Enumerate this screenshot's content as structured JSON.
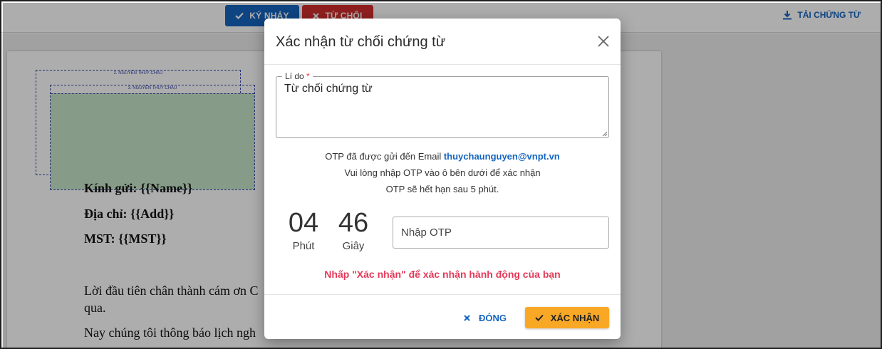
{
  "toolbar": {
    "sign_label": "KÝ NHÁY",
    "reject_label": "TỪ CHỐI",
    "download_label": "TẢI CHỨNG TỪ"
  },
  "document": {
    "signature_1": "2. NGUYỄN THÚY CHÂU",
    "signature_2": "3. NGUYỄN THÚY CHÂU",
    "recipient_line": "Kính gửi: {{Name}}",
    "address_line": "Địa chỉ: {{Add}}",
    "tax_line": "MST: {{MST}}",
    "para1_line1": "Lời đầu tiên chân thành cám ơn C",
    "para1_line2": "qua.",
    "para2_line1": "Nay chúng tôi thông báo lịch ngh"
  },
  "modal": {
    "title": "Xác nhận từ chối chứng từ",
    "reason_label": "Lí do",
    "reason_required": "*",
    "reason_value": "Từ chối chứng từ",
    "otp_sent_prefix": "OTP đã được gửi đến Email",
    "otp_email": "thuychaunguyen@vnpt.vn",
    "otp_instruction": "Vui lòng nhập OTP vào ô bên dưới để xác nhận",
    "otp_expiry": "OTP sẽ hết hạn sau 5 phút.",
    "timer_minutes": "04",
    "timer_minutes_label": "Phút",
    "timer_seconds": "46",
    "timer_seconds_label": "Giây",
    "otp_placeholder": "Nhập OTP",
    "hint": "Nhấp \"Xác nhận\" để xác nhận hành động của bạn",
    "close_label": "ĐÓNG",
    "confirm_label": "XÁC NHẬN"
  },
  "icons": {
    "sign": "check-icon",
    "reject": "x-icon",
    "download": "download-icon",
    "close_modal": "close-icon",
    "close_button": "x-icon",
    "confirm_button": "check-icon"
  },
  "colors": {
    "primary": "#1565c0",
    "danger": "#d32f2f",
    "warning": "#f9a825",
    "hint": "#e53958"
  }
}
